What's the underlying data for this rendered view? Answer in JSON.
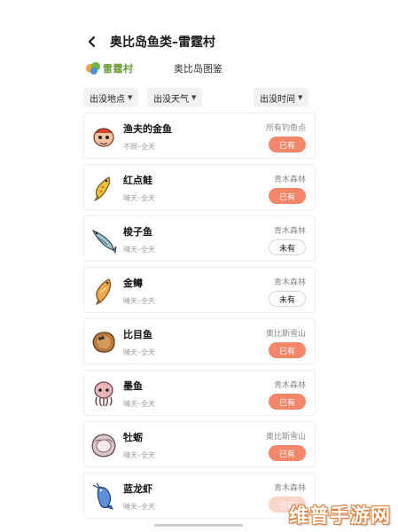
{
  "header": {
    "title": "奥比岛鱼类–雷霆村"
  },
  "brand": {
    "name": "雷霆村",
    "subtitle": "奥比岛图鉴"
  },
  "filters": [
    {
      "label": "出没地点"
    },
    {
      "label": "出没天气"
    },
    {
      "label": "出没时间"
    }
  ],
  "fish": [
    {
      "name": "渔夫的金鱼",
      "condition": "不限–全天",
      "location": "所有钓鱼点",
      "status": "已有",
      "owned": true,
      "icon": "goldfish-icon"
    },
    {
      "name": "红点鲑",
      "condition": "晴天–全天",
      "location": "青木森林",
      "status": "已有",
      "owned": true,
      "icon": "trout-icon"
    },
    {
      "name": "梭子鱼",
      "condition": "晴天–全天",
      "location": "青木森林",
      "status": "未有",
      "owned": false,
      "icon": "pike-icon"
    },
    {
      "name": "金鳟",
      "condition": "晴天–全天",
      "location": "青木森林",
      "status": "未有",
      "owned": false,
      "icon": "golden-trout-icon"
    },
    {
      "name": "比目鱼",
      "condition": "晴天–全天",
      "location": "奥比斯雪山",
      "status": "已有",
      "owned": true,
      "icon": "flounder-icon"
    },
    {
      "name": "墨鱼",
      "condition": "晴天–全天",
      "location": "青木森林",
      "status": "已有",
      "owned": true,
      "icon": "cuttlefish-icon"
    },
    {
      "name": "牡蛎",
      "condition": "晴天–全天",
      "location": "奥比斯雪山",
      "status": "已有",
      "owned": true,
      "icon": "oyster-icon"
    },
    {
      "name": "蓝龙虾",
      "condition": "晴天–全天",
      "location": "青木森林",
      "status": "已有",
      "owned": true,
      "icon": "blue-lobster-icon"
    }
  ],
  "watermark": "维普手游网",
  "colors": {
    "accent": "#f4876a",
    "brand_green": "#6a9b38",
    "watermark_orange": "#e07a2f"
  }
}
